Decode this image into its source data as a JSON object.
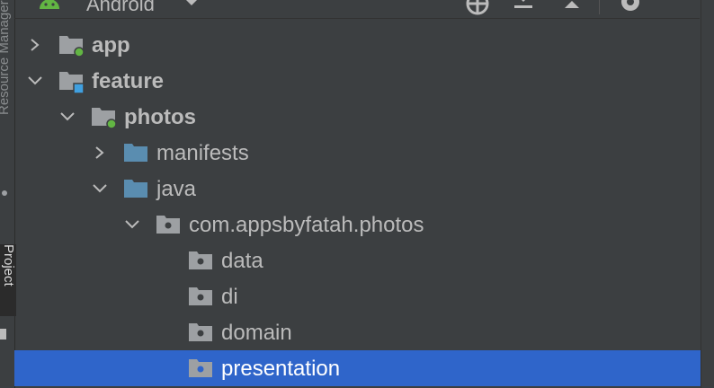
{
  "side_panel": {
    "vertical_label_top": "Resource Manager",
    "vertical_label_active": "Project"
  },
  "header": {
    "view_selector": "Android",
    "icons": [
      "android-icon",
      "chevron-down-icon",
      "locate-icon",
      "collapse-all-icon",
      "expand-all-icon",
      "gear-icon",
      "minimize-icon"
    ]
  },
  "tree": [
    {
      "label": "app",
      "bold": true,
      "expanded": false,
      "icon": "module-folder-green-dot"
    },
    {
      "label": "feature",
      "bold": true,
      "expanded": true,
      "icon": "module-folder-blue-square"
    },
    {
      "label": "photos",
      "bold": true,
      "expanded": true,
      "icon": "module-folder-green-dot"
    },
    {
      "label": "manifests",
      "bold": false,
      "expanded": false,
      "icon": "source-folder"
    },
    {
      "label": "java",
      "bold": false,
      "expanded": true,
      "icon": "source-folder"
    },
    {
      "label": "com.appsbyfatah.photos",
      "bold": false,
      "expanded": true,
      "icon": "package-folder"
    },
    {
      "label": "data",
      "bold": false,
      "icon": "package-folder"
    },
    {
      "label": "di",
      "bold": false,
      "icon": "package-folder"
    },
    {
      "label": "domain",
      "bold": false,
      "icon": "package-folder"
    },
    {
      "label": "presentation",
      "bold": false,
      "icon": "package-folder",
      "selected": true
    }
  ],
  "colors": {
    "background": "#3c3f41",
    "selection": "#2f65ca",
    "module_dot_green": "#62b543",
    "module_square_blue": "#40a0e0",
    "source_folder": "#5a8db0",
    "package_folder": "#9da0a3"
  }
}
